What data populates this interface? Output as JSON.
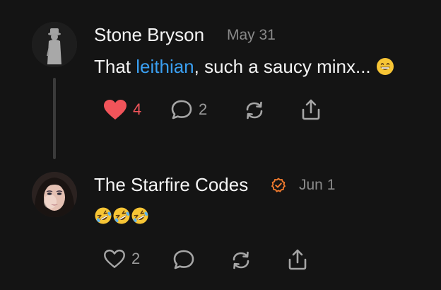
{
  "posts": [
    {
      "author": "Stone Bryson",
      "time": "May 31",
      "text_before": "That ",
      "mention": "leithian",
      "text_after": ", such a saucy minx...",
      "emoji": "grinning-face-with-smiling-eyes",
      "verified": false,
      "likes": "4",
      "liked": true,
      "replies": "2",
      "avatar": "silhouette-avatar-icon"
    },
    {
      "author": "The Starfire Codes",
      "time": "Jun 1",
      "emoji": "rolling-on-the-floor-laughing",
      "emoji_count": 3,
      "verified": true,
      "likes": "2",
      "liked": false,
      "avatar": "profile-photo"
    }
  ],
  "colors": {
    "background": "#141414",
    "mention": "#3a9ff1",
    "like_active": "#f1545a",
    "verified": "#f07a2e",
    "muted": "#8a8a8a"
  }
}
